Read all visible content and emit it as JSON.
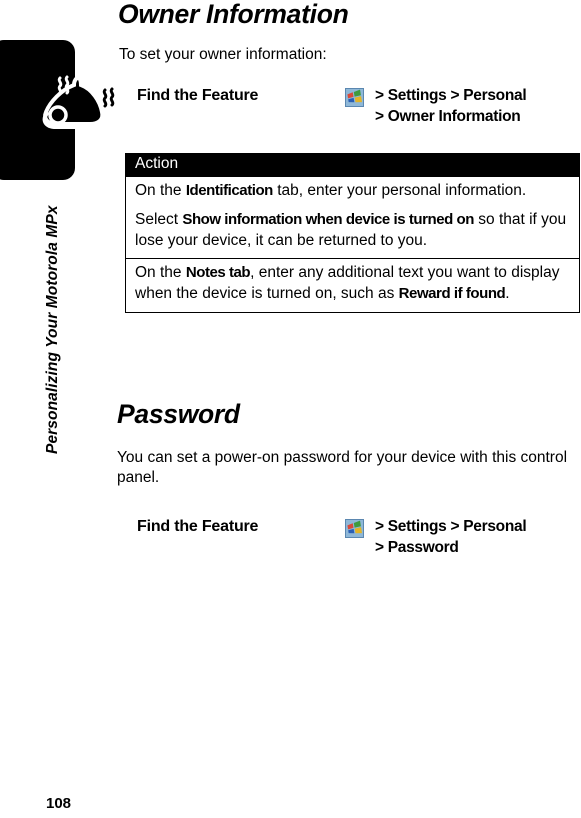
{
  "chapter": {
    "vertical_title": "Personalizing Your Motorola MPx",
    "page_number": "108",
    "tab_icon": "bell-icon"
  },
  "sections": [
    {
      "title": "Owner Information",
      "intro": "To set your owner information:",
      "find_feature": {
        "label": "Find the Feature",
        "icon": "windows-start-icon",
        "path_line1": "> Settings > Personal",
        "path_line2": "> Owner Information"
      }
    },
    {
      "title": "Password",
      "intro": "You can set a power-on password for your device with this control panel.",
      "find_feature": {
        "label": "Find the Feature",
        "icon": "windows-start-icon",
        "path_line1": "> Settings > Personal",
        "path_line2": "> Password"
      }
    }
  ],
  "action_table": {
    "header": "Action",
    "rows": [
      {
        "paragraphs": [
          [
            {
              "t": "On the ",
              "b": false
            },
            {
              "t": "Identification",
              "b": true
            },
            {
              "t": " tab, enter your personal information.",
              "b": false
            }
          ],
          [
            {
              "t": "Select ",
              "b": false
            },
            {
              "t": "Show information when device is turned on",
              "b": true
            },
            {
              "t": " so that if you lose your device, it can be returned to you.",
              "b": false
            }
          ]
        ]
      },
      {
        "paragraphs": [
          [
            {
              "t": "On the ",
              "b": false
            },
            {
              "t": "Notes tab",
              "b": true
            },
            {
              "t": ", enter any additional text you want to display when the device is turned on, such as ",
              "b": false
            },
            {
              "t": "Reward if found",
              "b": true
            },
            {
              "t": ".",
              "b": false
            }
          ]
        ]
      }
    ]
  },
  "colors": {
    "page_background": "#ffffff",
    "text": "#000000",
    "tab_fill": "#000000",
    "table_header_bg": "#000000",
    "table_header_text": "#ffffff",
    "icon_red": "#d94a3a",
    "icon_green": "#3f9b3f",
    "icon_blue": "#2b5fb5",
    "icon_yellow": "#e3b427",
    "icon_bg": "#8fb8d8"
  }
}
